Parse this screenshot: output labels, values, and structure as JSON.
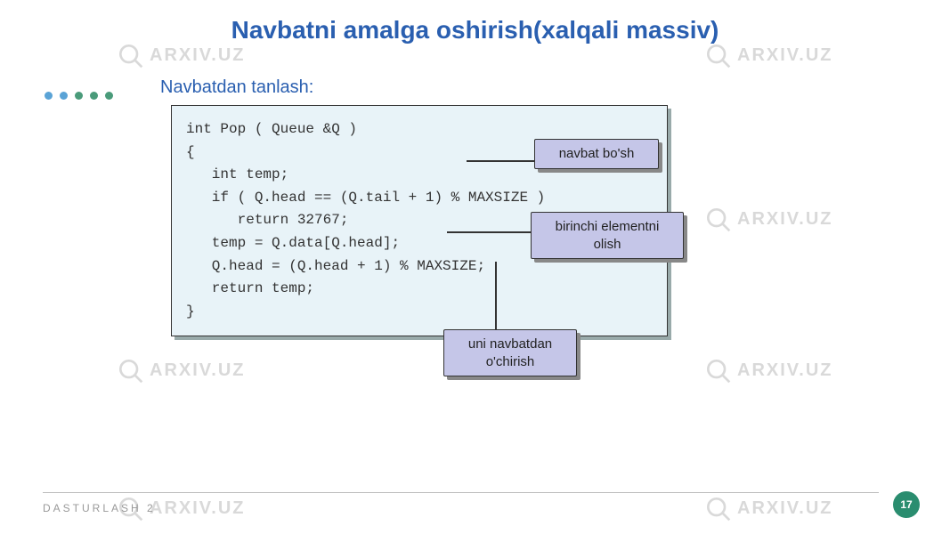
{
  "title": "Navbatni amalga oshirish(xalqali massiv)",
  "subtitle": "Navbatdan tanlash:",
  "code": "int Pop ( Queue &Q )\n{\n   int temp;\n   if ( Q.head == (Q.tail + 1) % MAXSIZE )\n      return 32767;\n   temp = Q.data[Q.head];\n   Q.head = (Q.head + 1) % MAXSIZE;\n   return temp;\n}",
  "callouts": {
    "c1": "navbat bo'sh",
    "c2_l1": "birinchi elementni",
    "c2_l2": "olish",
    "c3_l1": "uni navbatdan",
    "c3_l2": "o'chirish"
  },
  "footer": "DASTURLASH 2",
  "page": "17",
  "watermark_text": "ARXIV.UZ",
  "dot_colors": [
    "#5aa3d6",
    "#5aa3d6",
    "#4a9b7a",
    "#4a9b7a",
    "#4a9b7a"
  ]
}
